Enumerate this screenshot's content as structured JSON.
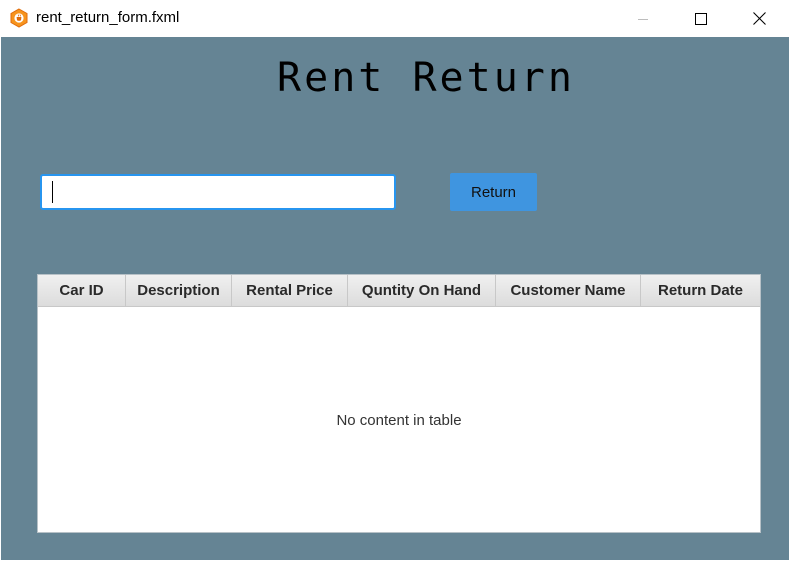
{
  "window": {
    "title": "rent_return_form.fxml",
    "icon": "java-coffee-cup-icon",
    "controls": [
      "minimize-icon",
      "maximize-icon",
      "close-icon"
    ]
  },
  "form": {
    "heading": "Rent Return",
    "search": {
      "value": "",
      "placeholder": ""
    },
    "return_button": "Return"
  },
  "table": {
    "columns": [
      "Car ID",
      "Description",
      "Rental Price",
      "Quntity On Hand",
      "Customer Name",
      "Return Date"
    ],
    "rows": [],
    "empty_message": "No content in table"
  },
  "colors": {
    "background": "#658494",
    "accent": "#3f95e0",
    "focus_border": "#2795ef"
  }
}
